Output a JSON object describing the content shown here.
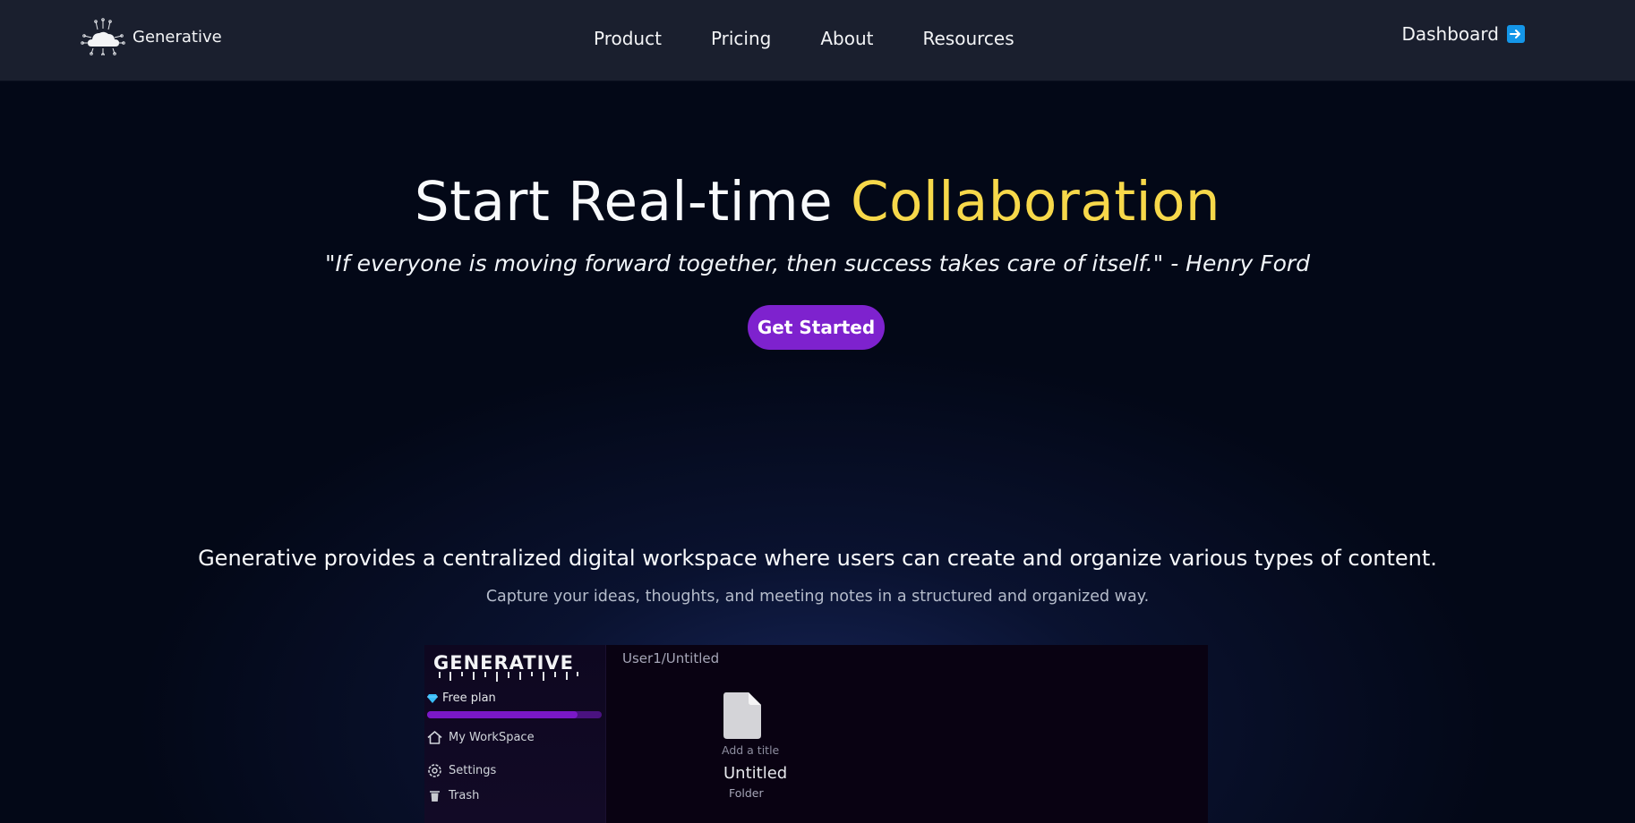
{
  "brand": {
    "name": "Generative",
    "logo_icon": "cloud-circuit-logo"
  },
  "nav": {
    "links": [
      "Product",
      "Pricing",
      "About",
      "Resources"
    ],
    "dashboard_label": "Dashboard",
    "dashboard_icon": "right-arrow-icon"
  },
  "hero": {
    "title_main": "Start Real-time",
    "title_accent": "Collaboration",
    "quote": "\"If everyone is moving forward together, then success takes care of itself.\" - Henry Ford",
    "cta_label": "Get Started"
  },
  "feature": {
    "heading": "Generative provides a centralized digital workspace where users can create and organize various types of content.",
    "subheading": "Capture your ideas, thoughts, and meeting notes in a structured and organized way."
  },
  "preview": {
    "logo_text": "GENERATIVE",
    "plan_label": "Free plan",
    "plan_progress": 0.86,
    "nav_items": [
      {
        "label": "My WorkSpace",
        "icon": "home-icon"
      },
      {
        "label": "Settings",
        "icon": "settings-icon"
      },
      {
        "label": "Trash",
        "icon": "trash-icon"
      }
    ],
    "breadcrumb": "User1/Untitled",
    "add_title_label": "Add a title",
    "doc_title": "Untitled",
    "doc_type": "Folder"
  },
  "colors": {
    "background": "#030817",
    "navbar": "#1a1f2e",
    "accent_yellow": "#f7d84a",
    "cta_purple": "#7e22ce",
    "arrow_blue": "#1496e8"
  }
}
